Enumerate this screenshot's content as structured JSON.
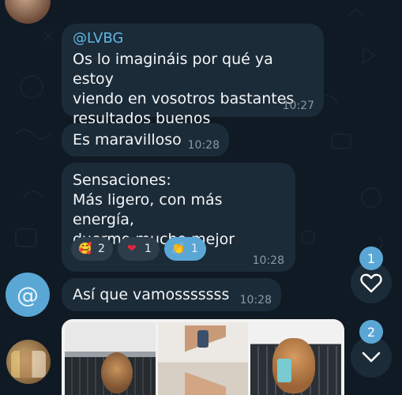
{
  "messages": [
    {
      "sender": "@LVBG",
      "text": "Os lo imagináis por qué ya estoy\nviendo en vosotros bastantes\nresultados buenos",
      "time": "10:27"
    },
    {
      "text": "Es maravilloso",
      "time": "10:28"
    },
    {
      "text": "Sensaciones:\nMás ligero, con más energía,\nduermo mucho mejor",
      "time": "10:28",
      "reactions": [
        {
          "emoji": "🥰",
          "icon": "smiling-face-with-hearts-icon",
          "count": "2"
        },
        {
          "emoji": "❤",
          "icon": "red-heart-icon",
          "count": "1"
        },
        {
          "emoji": "👏",
          "icon": "clapping-hands-icon",
          "count": "1",
          "active": true
        }
      ]
    },
    {
      "text": "Así que vamosssssss",
      "time": "10:28"
    }
  ],
  "avatar_at_label": "@",
  "side_buttons": {
    "reactions_badge": "1",
    "unread_badge": "2"
  },
  "colors": {
    "background": "#0f1a24",
    "bubble": "#1c2b38",
    "accent": "#5aa7d6",
    "sender": "#5fb8e6",
    "timestamp": "#8a98a5",
    "heart_outline": "#ffffff"
  }
}
